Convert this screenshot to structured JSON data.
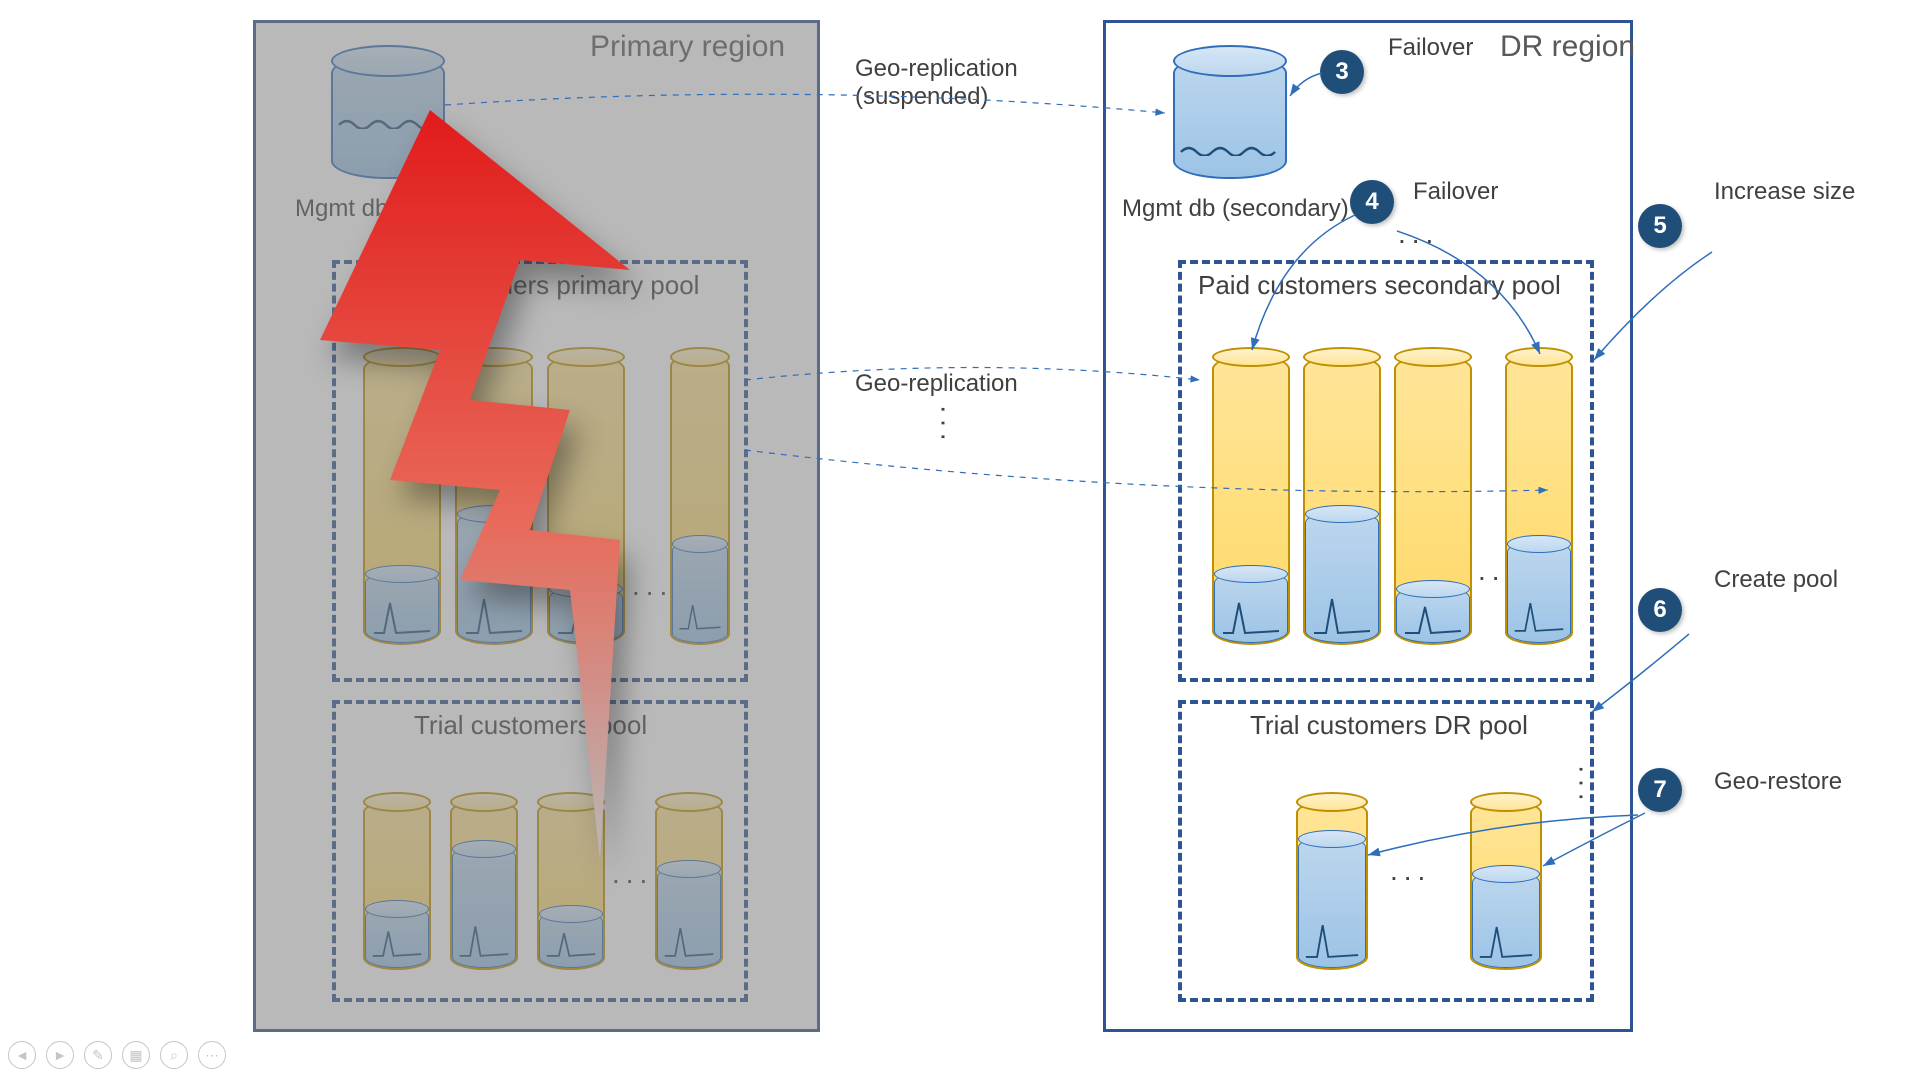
{
  "primary": {
    "title": "Primary region",
    "mgmt_db": "Mgmt db (primary)",
    "paid_pool": "Paid customers primary pool",
    "trial_pool": "Trial customers pool"
  },
  "dr": {
    "title": "DR region",
    "mgmt_db": "Mgmt db (secondary)",
    "paid_pool": "Paid customers secondary pool",
    "trial_pool": "Trial customers DR pool"
  },
  "labels": {
    "geo_repl_susp_1": "Geo-replication",
    "geo_repl_susp_2": "(suspended)",
    "geo_repl": "Geo-replication"
  },
  "steps": {
    "s3": {
      "num": "3",
      "text": "Failover"
    },
    "s4": {
      "num": "4",
      "text": "Failover"
    },
    "s5": {
      "num": "5",
      "text": "Increase size"
    },
    "s6": {
      "num": "6",
      "text": "Create pool"
    },
    "s7": {
      "num": "7",
      "text": "Geo-restore"
    }
  },
  "ellipsis": "…",
  "ellipsis3": "..."
}
